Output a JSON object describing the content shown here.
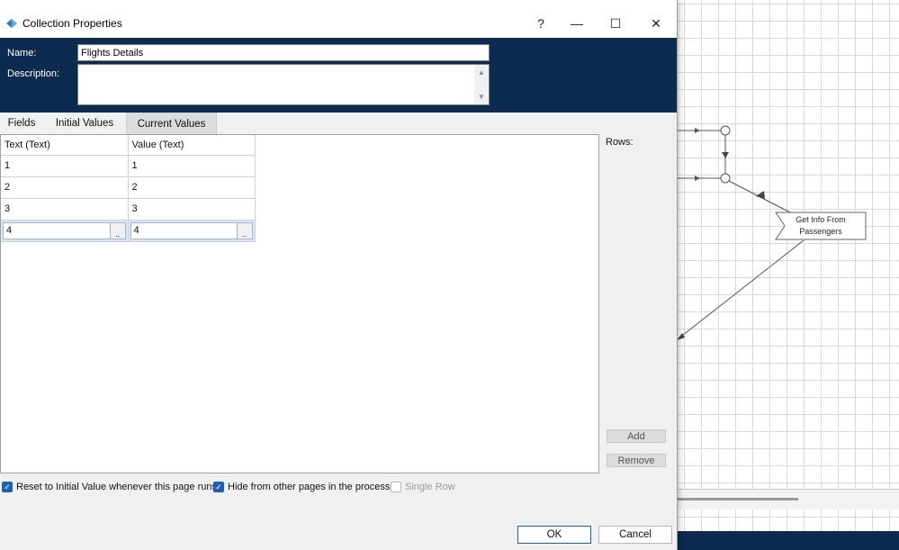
{
  "window": {
    "title": "Collection Properties",
    "help_label": "?",
    "minimize_label": "—",
    "maximize_label": "☐",
    "close_label": "✕",
    "app_icon": "collection-app-icon"
  },
  "header": {
    "name_label": "Name:",
    "name_value": "Flights Details",
    "description_label": "Description:",
    "description_value": ""
  },
  "tabs": [
    {
      "label": "Fields"
    },
    {
      "label": "Initial Values"
    },
    {
      "label": "Current Values"
    }
  ],
  "active_tab": "Current Values",
  "grid": {
    "columns": [
      "Text (Text)",
      "Value (Text)"
    ],
    "rows": [
      [
        "1",
        "1"
      ],
      [
        "2",
        "2"
      ],
      [
        "3",
        "3"
      ],
      [
        "4",
        "4"
      ]
    ],
    "selected_row_index": 3,
    "ellipsis_label": ".."
  },
  "side_panel": {
    "rows_label": "Rows:",
    "add_label": "Add",
    "remove_label": "Remove"
  },
  "options": {
    "reset_label": "Reset to Initial Value whenever this page runs",
    "reset_checked": true,
    "hide_label": "Hide from other pages in the process",
    "hide_checked": true,
    "single_row_label": "Single Row",
    "single_row_checked": false
  },
  "footer": {
    "ok_label": "OK",
    "cancel_label": "Cancel"
  },
  "canvas": {
    "stage_label": "Get Info From Passengers"
  },
  "colors": {
    "header_navy": "#0d2b4e",
    "accent_blue": "#1f5fb4"
  }
}
